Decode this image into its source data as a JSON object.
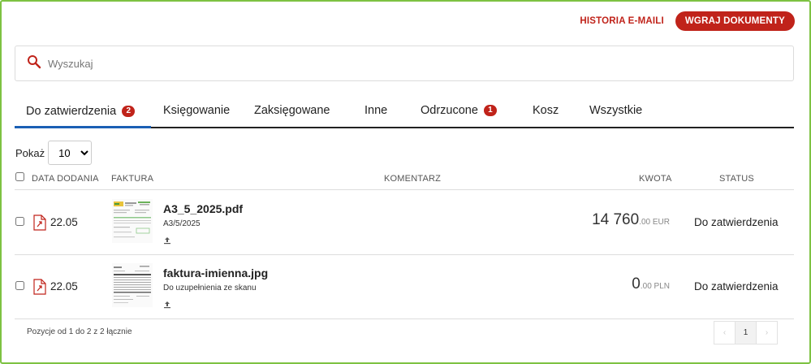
{
  "header": {
    "email_history_label": "HISTORIA E-MAILI",
    "upload_button_label": "WGRAJ DOKUMENTY",
    "accent_color": "#c0231a"
  },
  "search": {
    "placeholder": "Wyszukaj",
    "value": "",
    "icon": "search-icon"
  },
  "tabs": [
    {
      "label": "Do zatwierdzenia",
      "badge": "2",
      "active": true
    },
    {
      "label": "Księgowanie"
    },
    {
      "label": "Zaksięgowane"
    },
    {
      "label": "Inne"
    },
    {
      "label": "Odrzucone",
      "badge": "1"
    },
    {
      "label": "Kosz"
    },
    {
      "label": "Wszystkie"
    }
  ],
  "page_size": {
    "label": "Pokaż",
    "value": "10"
  },
  "table": {
    "columns": {
      "date": "DATA DODANIA",
      "invoice": "FAKTURA",
      "comment": "KOMENTARZ",
      "amount": "KWOTA",
      "status": "STATUS"
    },
    "rows": [
      {
        "date": "22.05",
        "file_name": "A3_5_2025.pdf",
        "file_sub": "A3/5/2025",
        "amount_main": "14 760",
        "amount_suffix": ".00 EUR",
        "status": "Do zatwierdzenia"
      },
      {
        "date": "22.05",
        "file_name": "faktura-imienna.jpg",
        "file_sub": "Do uzupełnienia ze skanu",
        "amount_main": "0",
        "amount_suffix": ".00 PLN",
        "status": "Do zatwierdzenia"
      }
    ]
  },
  "footer": {
    "summary": "Pozycje od 1 do 2 z 2 łącznie",
    "prev": "‹",
    "current_page": "1",
    "next": "›"
  }
}
